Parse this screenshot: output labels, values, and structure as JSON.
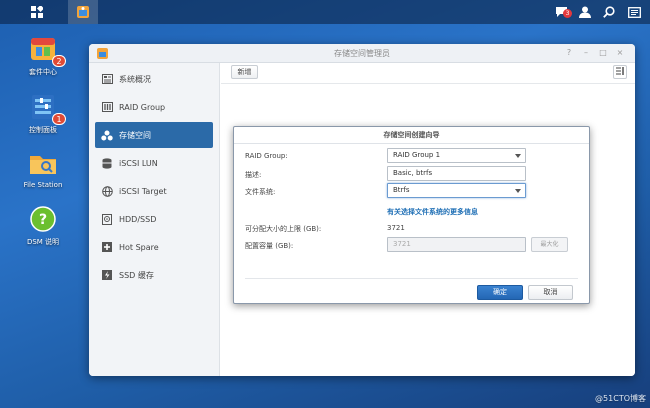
{
  "desktop": {
    "icons": [
      {
        "label": "套件中心",
        "badge": "2",
        "icon": "package-center-icon"
      },
      {
        "label": "控制面板",
        "badge": "1",
        "icon": "control-panel-icon"
      },
      {
        "label": "File Station",
        "icon": "folder-icon"
      },
      {
        "label": "DSM 说明",
        "icon": "help-icon"
      }
    ]
  },
  "taskbar": {
    "chat_badge": "3",
    "icons": [
      "main-menu-icon",
      "storage-manager-icon",
      "chat-icon",
      "user-icon",
      "search-icon",
      "widgets-icon"
    ]
  },
  "window": {
    "title": "存储空间管理员",
    "controls": [
      "?",
      "–",
      "□",
      "×"
    ],
    "sidebar": [
      {
        "label": "系统概况",
        "icon": "overview-icon",
        "active": false
      },
      {
        "label": "RAID Group",
        "icon": "raid-group-icon",
        "active": false
      },
      {
        "label": "存储空间",
        "icon": "volume-icon",
        "active": true
      },
      {
        "label": "iSCSI LUN",
        "icon": "iscsi-lun-icon",
        "active": false
      },
      {
        "label": "iSCSI Target",
        "icon": "iscsi-target-icon",
        "active": false
      },
      {
        "label": "HDD/SSD",
        "icon": "hdd-icon",
        "active": false
      },
      {
        "label": "Hot Spare",
        "icon": "hot-spare-icon",
        "active": false
      },
      {
        "label": "SSD 缓存",
        "icon": "ssd-cache-icon",
        "active": false
      }
    ],
    "toolbar": {
      "new_label": "新增"
    }
  },
  "dialog": {
    "title": "存储空间创建向导",
    "fields": {
      "raid_group": {
        "label": "RAID Group:",
        "value": "RAID Group 1"
      },
      "description": {
        "label": "描述:",
        "value": "Basic, btrfs"
      },
      "filesystem": {
        "label": "文件系统:",
        "value": "Btrfs"
      }
    },
    "fs_info_link": "有关选择文件系统的更多信息",
    "max_size": {
      "label": "可分配大小的上限 (GB):",
      "value": "3721"
    },
    "capacity": {
      "label": "配置容量 (GB):",
      "value": "3721"
    },
    "max_button": "最大化",
    "ok_button": "确定",
    "cancel_button": "取消"
  },
  "watermark": "@51CTO博客",
  "colors": {
    "accent": "#2b6aa8",
    "link": "#1f6fb5",
    "badge": "#e04b36"
  }
}
